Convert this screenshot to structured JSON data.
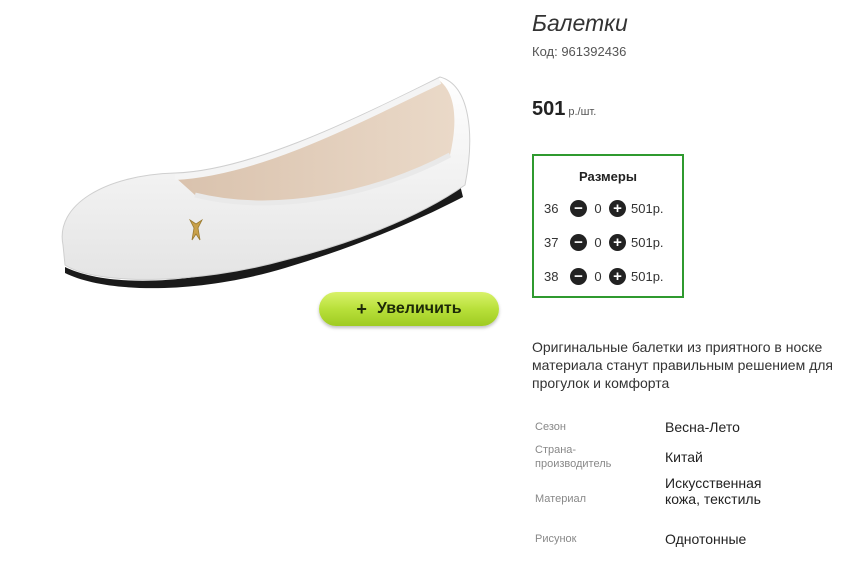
{
  "product": {
    "title": "Балетки",
    "code": "Код: 961392436",
    "price": "501",
    "price_unit": "р./шт.",
    "zoom_label": "Увеличить",
    "zoom_symbol": "+"
  },
  "sizes": {
    "title": "Размеры",
    "rows": [
      {
        "size": "36",
        "qty": "0",
        "price": "501р."
      },
      {
        "size": "37",
        "qty": "0",
        "price": "501р."
      },
      {
        "size": "38",
        "qty": "0",
        "price": "501р."
      }
    ],
    "minus_symbol": "−",
    "plus_symbol": "+"
  },
  "description": "Оригинальные балетки из приятного в носке материала станут правильным решением для прогулок и комфорта",
  "specs": [
    {
      "label": "Сезон",
      "value": "Весна-Лето"
    },
    {
      "label": "Страна-производитель",
      "value": "Китай"
    },
    {
      "label": "Материал",
      "value": "Искусственная кожа, текстиль"
    },
    {
      "label": "Рисунок",
      "value": "Однотонные"
    }
  ],
  "colors": {
    "accent_green": "#2f9a2f",
    "button_green": "#b8e03a"
  }
}
